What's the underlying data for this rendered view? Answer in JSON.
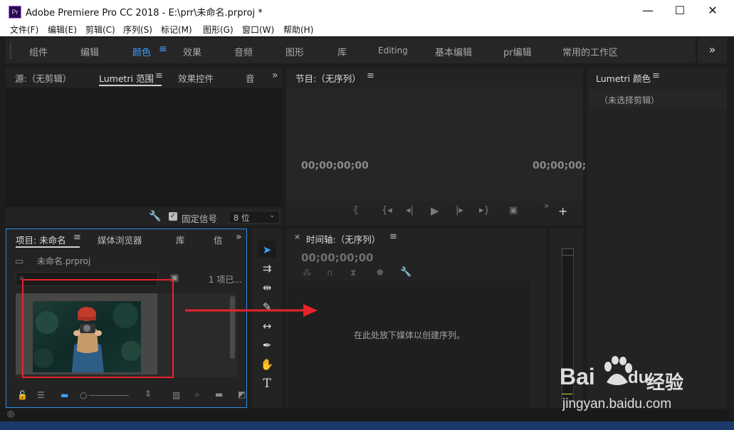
{
  "window": {
    "app_badge": "Pr",
    "title": "Adobe Premiere Pro CC 2018 - E:\\prr\\未命名.prproj *",
    "minimize": "—",
    "maximize": "☐",
    "close": "✕"
  },
  "menu": [
    "文件(F)",
    "编辑(E)",
    "剪辑(C)",
    "序列(S)",
    "标记(M)",
    "图形(G)",
    "窗口(W)",
    "帮助(H)"
  ],
  "workspaces": {
    "items": [
      "组件",
      "编辑",
      "颜色",
      "效果",
      "音频",
      "图形",
      "库",
      "Editing",
      "基本编辑",
      "pr编辑",
      "常用的工作区"
    ],
    "active": "颜色",
    "overflow": "»"
  },
  "source_panel": {
    "tabs": [
      "源:（无剪辑）",
      "Lumetri 范围",
      "效果控件",
      "音"
    ],
    "active_tab": "Lumetri 范围",
    "lock_label": "固定信号",
    "bit_depth": "8 位"
  },
  "program_panel": {
    "title": "节目:（无序列）",
    "timecode_left": "00;00;00;00",
    "timecode_right": "00;00;00;"
  },
  "lumetri_panel": {
    "title": "Lumetri 颜色",
    "no_clip": "（未选择剪辑）"
  },
  "project_panel": {
    "tabs": [
      "项目: 未命名",
      "媒体浏览器",
      "库",
      "信"
    ],
    "active_tab": "项目: 未命名",
    "file": "未命名.prproj",
    "count": "1 项已..."
  },
  "timeline_panel": {
    "title": "时间轴:（无序列）",
    "timecode": "00;00;00;00",
    "drop_hint": "在此处放下媒体以创建序列。"
  },
  "watermark": {
    "brand": "Bai",
    "brand2": "du",
    "cn": "经验",
    "url": "jingyan.baidu.com"
  },
  "colors": {
    "accent": "#3aa0ff",
    "annotation": "#e8232a",
    "selection_border": "#2d8ceb"
  }
}
